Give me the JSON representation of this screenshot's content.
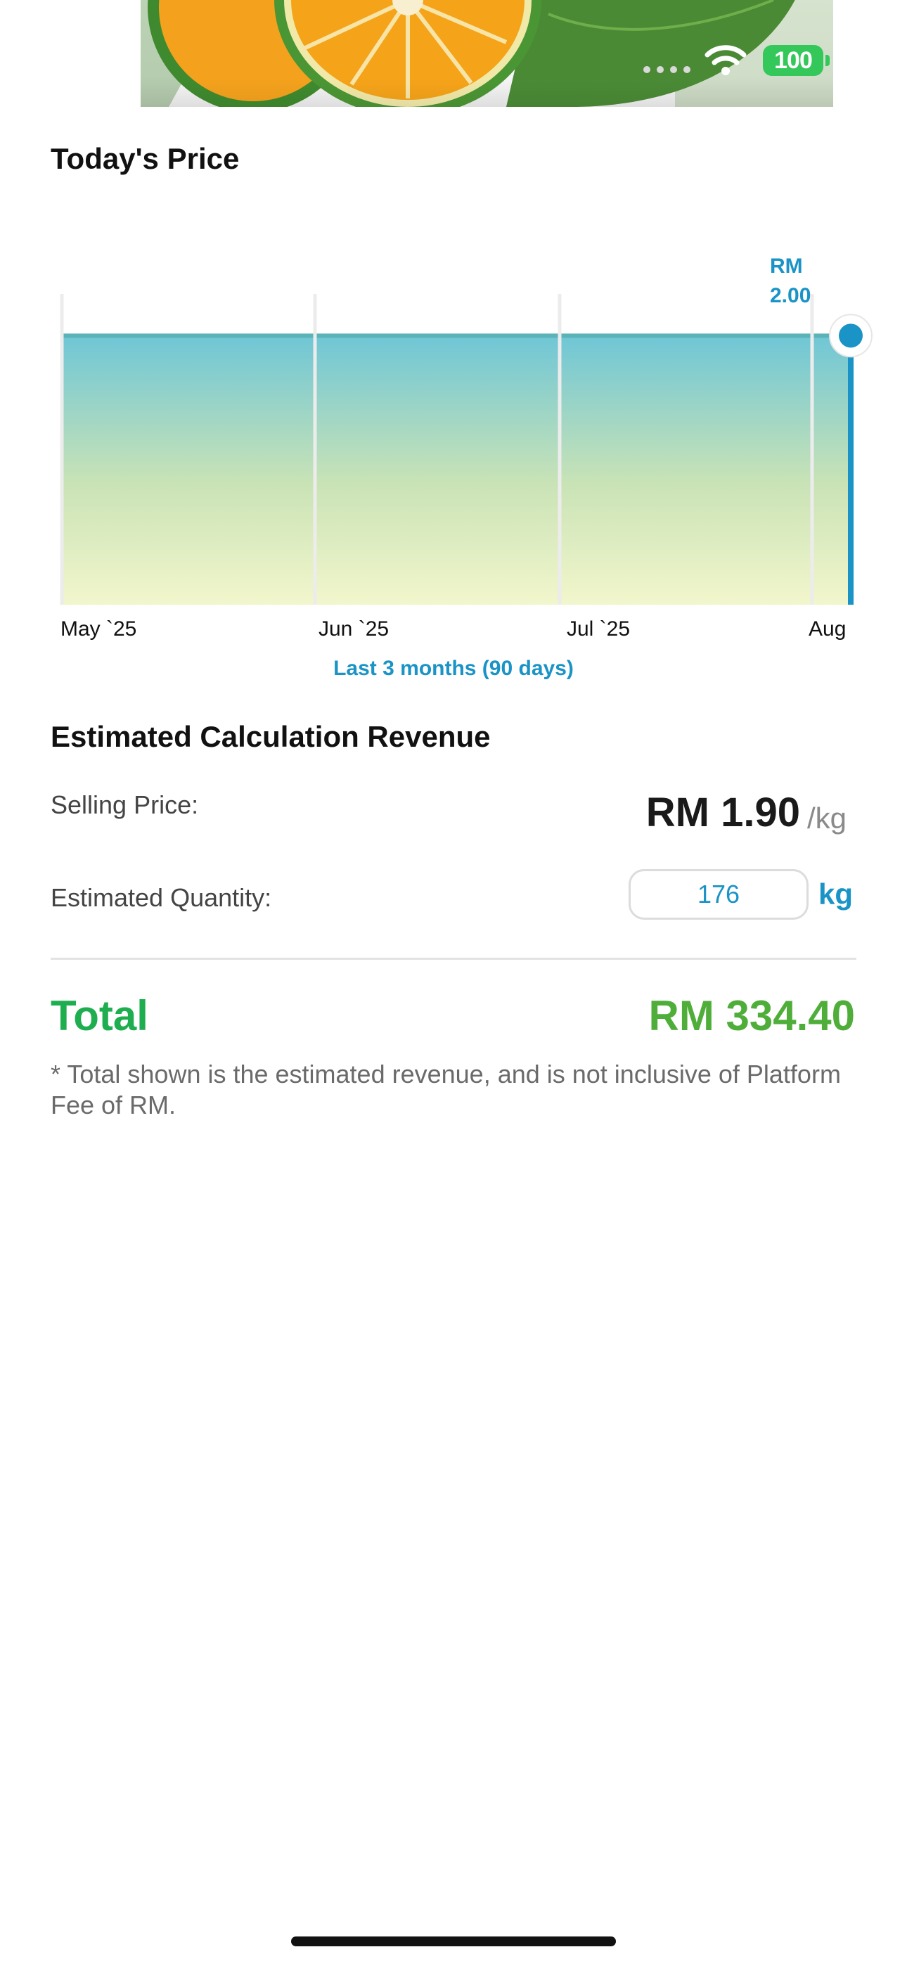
{
  "status_bar": {
    "battery": "100"
  },
  "hero": {
    "alt": "Limau (citrus) fruit"
  },
  "todays_price": {
    "title": "Today's Price",
    "tooltip_line1": "RM",
    "tooltip_line2": "2.00",
    "range_label": "Last 3 months (90 days)"
  },
  "chart_data": {
    "type": "area",
    "x": [
      "May `25",
      "Jun `25",
      "Jul `25",
      "Aug"
    ],
    "values": [
      2.0,
      2.0,
      2.0,
      2.0
    ],
    "title": "",
    "xlabel": "",
    "ylabel": "",
    "highlight": {
      "x": "Aug",
      "value": 2.0,
      "label": "RM 2.00"
    },
    "colors": {
      "line": "#5bb3b5",
      "fill_top": "#6fc6d6",
      "fill_bottom": "#f3f6cc",
      "marker": "#1a93c6"
    }
  },
  "calculation": {
    "title": "Estimated Calculation Revenue",
    "selling_label": "Selling Price:",
    "selling_value": "RM 1.90",
    "selling_unit": "/kg",
    "quantity_label": "Estimated Quantity:",
    "quantity_value": "176",
    "quantity_unit": "kg",
    "total_label": "Total",
    "total_value": "RM 334.40",
    "disclaimer": "* Total shown is the estimated revenue, and is not inclusive of Platform Fee of RM."
  },
  "colors": {
    "accent": "#1a93c6",
    "green": "#1fae4f",
    "battery": "#34c759"
  }
}
